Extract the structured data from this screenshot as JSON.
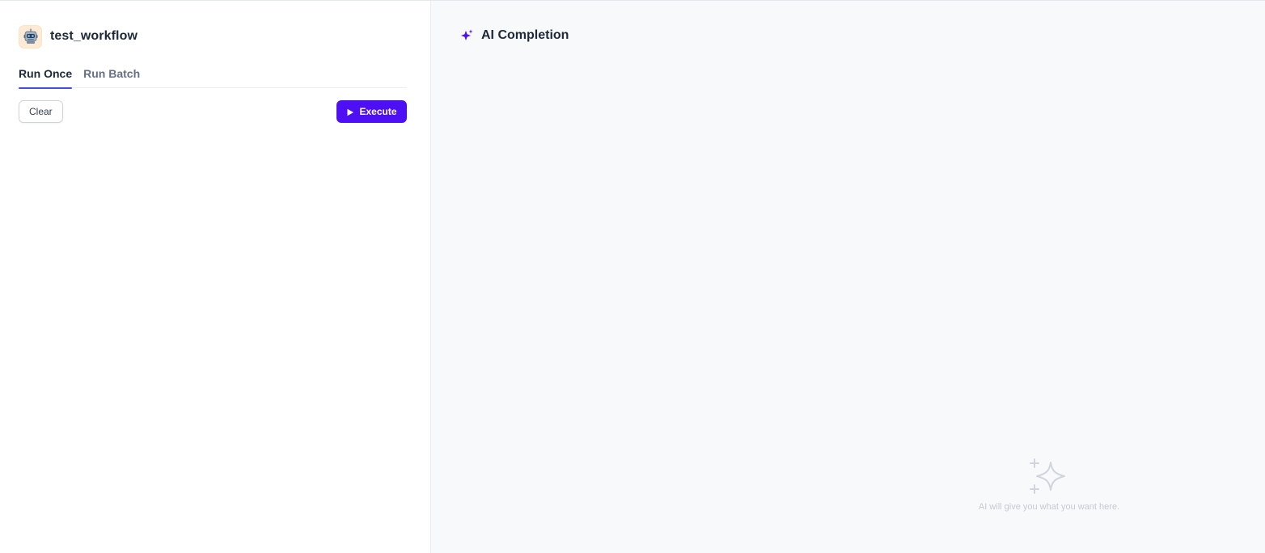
{
  "app": {
    "title": "test_workflow",
    "icon": "robot-icon",
    "icon_bg": "#ffead5"
  },
  "tabs": [
    {
      "label": "Run Once",
      "active": true
    },
    {
      "label": "Run Batch",
      "active": false
    }
  ],
  "actions": {
    "clear_label": "Clear",
    "execute_label": "Execute",
    "execute_icon": "play-icon",
    "accent_color": "#4f0ff5"
  },
  "result": {
    "title": "AI Completion",
    "title_icon": "sparkle-icon",
    "empty_text": "AI will give you what you want here.",
    "empty_icon": "sparkles-outline-icon"
  }
}
